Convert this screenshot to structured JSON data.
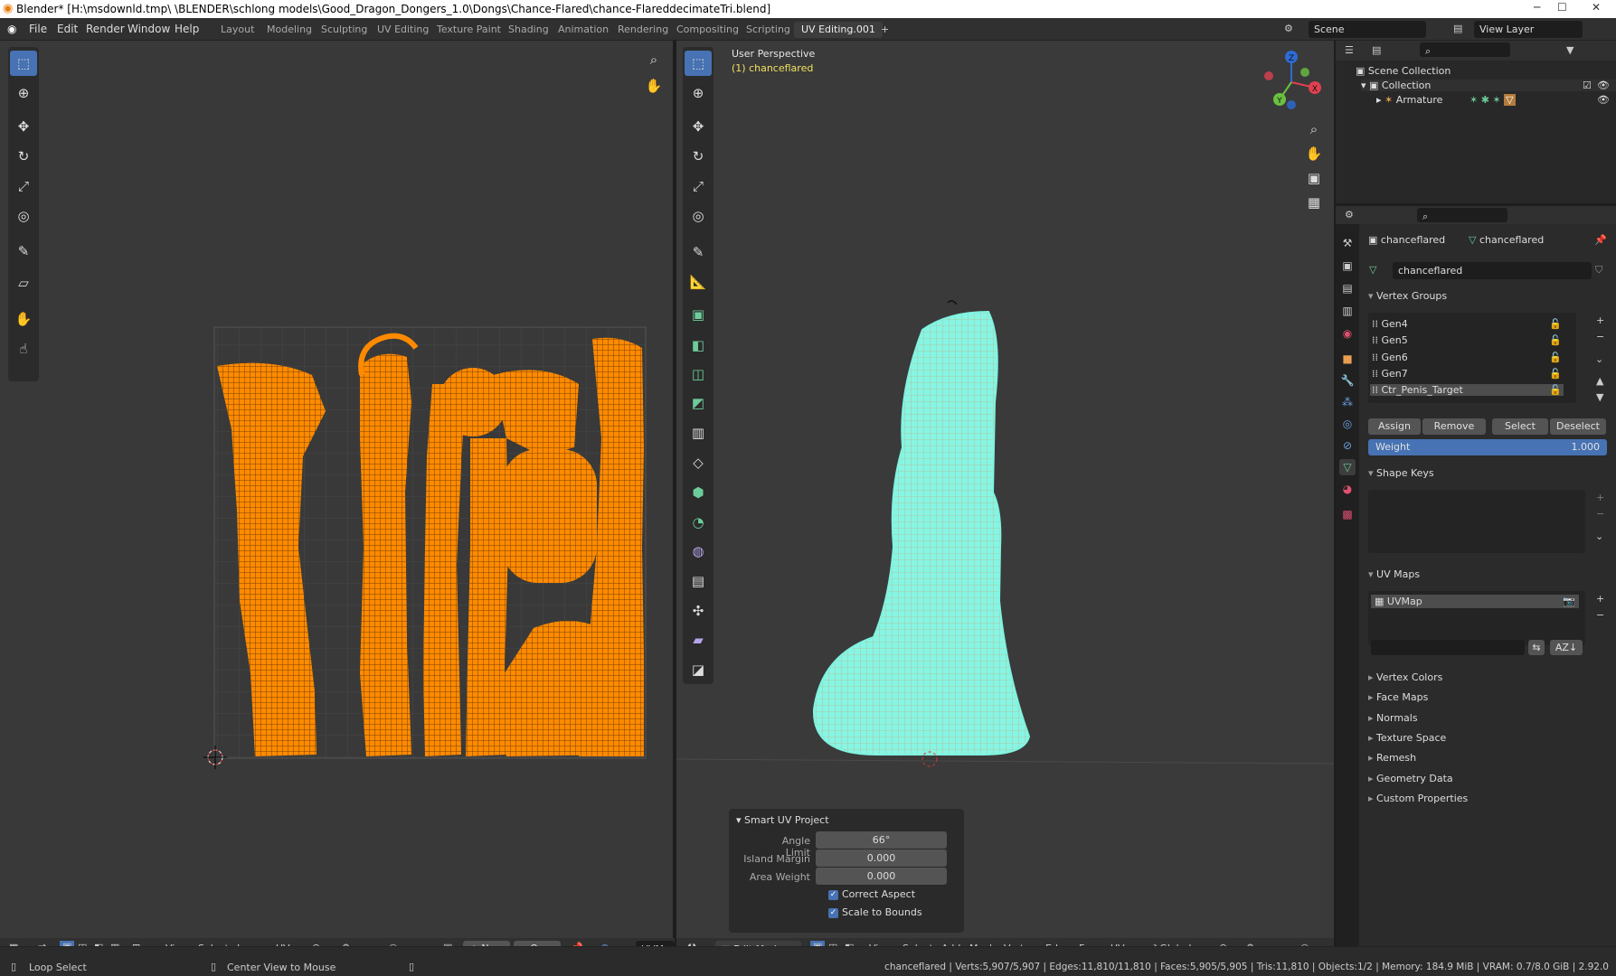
{
  "title": "Blender* [H:\\msdownld.tmp\\ \\BLENDER\\schlong models\\Good_Dragon_Dongers_1.0\\Dongs\\Chance-Flared\\chance-FlareddecimateTri.blend]",
  "window_controls": {
    "minimize": "─",
    "maximize": "☐",
    "close": "✕"
  },
  "menu": [
    "File",
    "Edit",
    "Render",
    "Window",
    "Help"
  ],
  "workspaces": [
    "Layout",
    "Modeling",
    "Sculpting",
    "UV Editing",
    "Texture Paint",
    "Shading",
    "Animation",
    "Rendering",
    "Compositing",
    "Scripting",
    "UV Editing.001"
  ],
  "add_workspace": "+",
  "scene": {
    "name": "Scene",
    "view_layer": "View Layer"
  },
  "viewport": {
    "line1": "User Perspective",
    "line2": "(1) chanceflared"
  },
  "axes": {
    "x": "X",
    "y": "Y",
    "z": "Z"
  },
  "outliner": {
    "scene_collection": "Scene Collection",
    "collection": "Collection",
    "armature": "Armature"
  },
  "props": {
    "object": "chanceflared",
    "mesh": "chanceflared",
    "mesh_field": "chanceflared",
    "vertex_groups_title": "Vertex Groups",
    "vertex_groups": [
      "Gen4",
      "Gen5",
      "Gen6",
      "Gen7",
      "Ctr_Penis_Target"
    ],
    "assign": "Assign",
    "remove": "Remove",
    "select": "Select",
    "deselect": "Deselect",
    "weight_label": "Weight",
    "weight_value": "1.000",
    "shape_keys": "Shape Keys",
    "uv_maps": "UV Maps",
    "uvmap": "UVMap",
    "collapsed": [
      "Vertex Colors",
      "Face Maps",
      "Normals",
      "Texture Space",
      "Remesh",
      "Geometry Data",
      "Custom Properties"
    ]
  },
  "redo": {
    "title": "Smart UV Project",
    "angle_label": "Angle Limit",
    "angle": "66°",
    "margin_label": "Island Margin",
    "margin": "0.000",
    "weight_label": "Area Weight",
    "weight": "0.000",
    "correct": "Correct Aspect",
    "scale": "Scale to Bounds"
  },
  "uv_header": {
    "view": "View",
    "select": "Select",
    "image": "Image",
    "uv": "UV",
    "new": "New",
    "open": "Open",
    "uvmap": "UVMap"
  },
  "vp_header": {
    "mode": "Edit Mode",
    "view": "View",
    "select": "Select",
    "add": "Add",
    "mesh": "Mesh",
    "vertex": "Vertex",
    "edge": "Edge",
    "face": "Face",
    "uv": "UV",
    "orientation": "Global"
  },
  "status": {
    "left": "Loop Select",
    "mid": "Center View to Mouse",
    "right": "chanceflared | Verts:5,907/5,907 | Edges:11,810/11,810 | Faces:5,905/5,905 | Tris:11,810 | Objects:1/2 | Memory: 184.9 MiB | VRAM: 0.7/8.0 GiB | 2.92.0"
  },
  "colors": {
    "accent": "#4772b3",
    "uv": "#ff8a00",
    "mesh": "#7ff3e0",
    "header": "#303030"
  }
}
